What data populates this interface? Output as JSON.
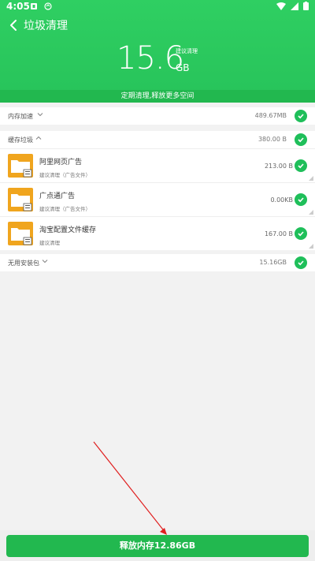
{
  "status_bar": {
    "time": "4:05"
  },
  "header": {
    "title": "垃圾清理",
    "size_value": "15.6",
    "size_unit": "GB",
    "size_advice": "建议清理",
    "tip": "定期清理,释放更多空间"
  },
  "categories": [
    {
      "label": "内存加速",
      "value": "489.67MB",
      "expanded": false
    },
    {
      "label": "缓存垃圾",
      "value": "380.00 B",
      "expanded": true
    },
    {
      "label": "无用安装包",
      "value": "15.16GB",
      "expanded": false
    }
  ],
  "cache_items": [
    {
      "name": "阿里网页广告",
      "sub": "建议清理（广告文件）",
      "value": "213.00 B"
    },
    {
      "name": "广点通广告",
      "sub": "建议清理（广告文件）",
      "value": "0.00KB"
    },
    {
      "name": "淘宝配置文件缓存",
      "sub": "建议清理",
      "value": "167.00 B"
    }
  ],
  "footer": {
    "button_label": "释放内存12.86GB"
  },
  "colors": {
    "primary": "#27c35a",
    "check": "#1fbf5a",
    "folder": "#f0a51e",
    "arrow": "#e02020"
  }
}
